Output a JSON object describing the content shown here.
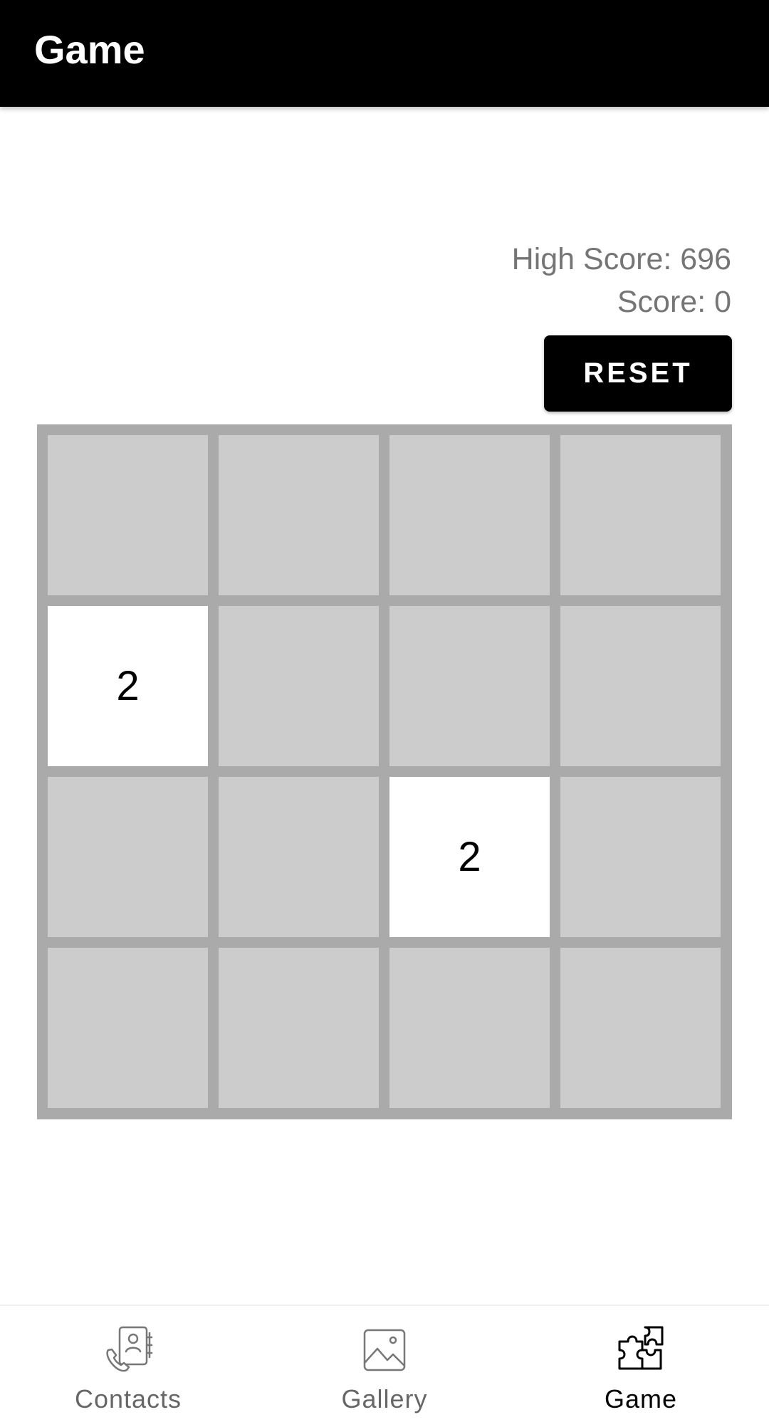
{
  "appbar": {
    "title": "Game"
  },
  "scores": {
    "high_score_text": "High Score: 696",
    "score_text": "Score: 0"
  },
  "controls": {
    "reset_label": "RESET"
  },
  "board": {
    "tiles": [
      [
        "",
        "",
        "",
        ""
      ],
      [
        "2",
        "",
        "",
        ""
      ],
      [
        "",
        "",
        "2",
        ""
      ],
      [
        "",
        "",
        "",
        ""
      ]
    ]
  },
  "bottom_nav": {
    "items": [
      {
        "label": "Contacts",
        "icon": "contacts-icon",
        "active": false
      },
      {
        "label": "Gallery",
        "icon": "gallery-icon",
        "active": false
      },
      {
        "label": "Game",
        "icon": "puzzle-icon",
        "active": true
      }
    ]
  },
  "colors": {
    "appbar_bg": "#000000",
    "board_bg": "#aaaaaa",
    "empty_tile": "#cccccc",
    "filled_tile": "#ffffff",
    "score_text": "#757575"
  }
}
